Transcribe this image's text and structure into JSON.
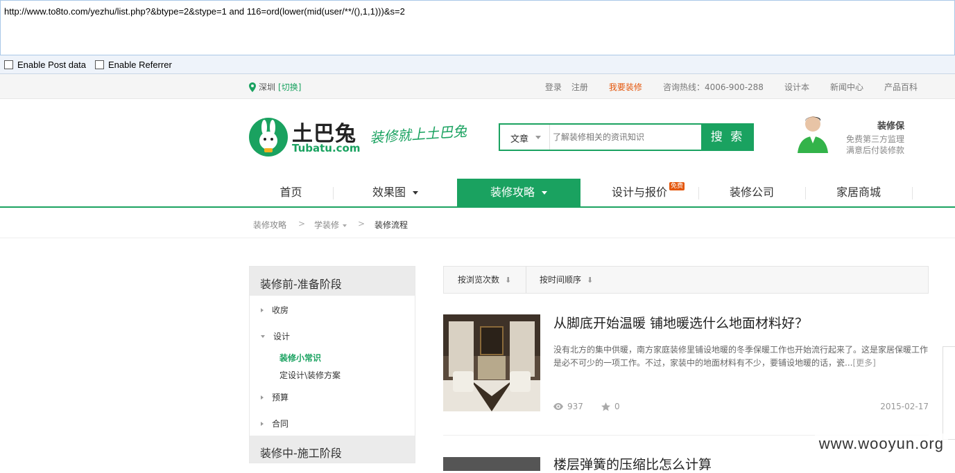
{
  "browser": {
    "url": "http://www.to8to.com/yezhu/list.php?&btype=2&stype=1 and 116=ord(lower(mid(user/**/(),1,1)))&s=2",
    "enable_post": "Enable Post data",
    "enable_referrer": "Enable Referrer"
  },
  "topbar": {
    "city": "深圳",
    "switch": "[切换]",
    "links": [
      "登录",
      "注册",
      "我要装修",
      "咨询热线：4006-900-288",
      "设计本",
      "新闻中心",
      "产品百科"
    ]
  },
  "logo": {
    "cn": "土巴兔",
    "en": "Tubatu.com",
    "slogan": "装修就上土巴兔"
  },
  "search": {
    "category": "文章",
    "placeholder": "了解装修相关的资讯知识",
    "button": "搜 索"
  },
  "guarantee": {
    "title": "装修保",
    "line1": "免费第三方监理",
    "line2": "满意后付装修款"
  },
  "nav": {
    "items": [
      "首页",
      "效果图",
      "装修攻略",
      "设计与报价",
      "装修公司",
      "家居商城"
    ],
    "badge": "免费"
  },
  "breadcrumb": [
    "装修攻略",
    "学装修",
    "装修流程"
  ],
  "sidebar": {
    "section1": "装修前-准备阶段",
    "items": [
      "收房",
      "设计",
      "预算",
      "合同"
    ],
    "subitems": [
      "装修小常识",
      "定设计\\装修方案"
    ],
    "section2": "装修中-施工阶段"
  },
  "sort": {
    "by_views": "按浏览次数",
    "by_time": "按时间顺序"
  },
  "article1": {
    "title": "从脚底开始温暖 铺地暖选什么地面材料好？",
    "desc": "没有北方的集中供暖，南方家庭装修里铺设地暖的冬季保暖工作也开始流行起来了。这是家居保暖工作是必不可少的一项工作。不过，家装中的地面材料有不少，要铺设地暖的话，瓷...",
    "more": "[更多]",
    "views": "937",
    "likes": "0",
    "date": "2015-02-17"
  },
  "article2": {
    "title": "楼层弹簧的压缩比怎么计算"
  },
  "watermark": "www.wooyun.org",
  "colors": {
    "brand": "#1aa260",
    "accent": "#e4560b"
  }
}
